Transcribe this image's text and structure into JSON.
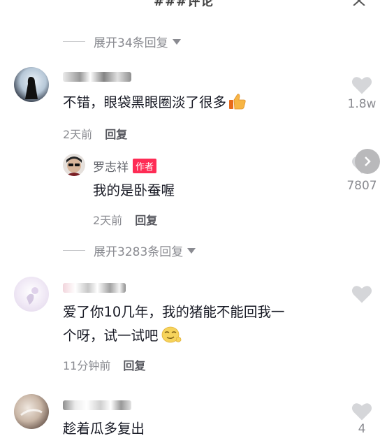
{
  "header": {
    "title": "###评论"
  },
  "thread1": {
    "expand_label": "展开34条回复"
  },
  "comment1": {
    "text": "不错，眼袋黑眼圈淡了很多",
    "time": "2天前",
    "reply_label": "回复",
    "likes": "1.8w"
  },
  "reply1": {
    "username": "罗志祥",
    "badge": "作者",
    "text": "我的是卧蚕喔",
    "time": "2天前",
    "reply_label": "回复",
    "likes": "7807"
  },
  "thread2": {
    "expand_label": "展开3283条回复"
  },
  "comment2": {
    "text_line1": "爱了你10几年，我的猪能不能回我一",
    "text_line2": "个呀，试一试吧",
    "time": "11分钟前",
    "reply_label": "回复"
  },
  "comment3": {
    "text": "趁着瓜多复出",
    "likes": "4"
  },
  "colors": {
    "accent": "#fe2c55",
    "muted": "#8a8b91",
    "heart": "#d5d6d9"
  },
  "icons": [
    "close-icon",
    "chevron-down-icon",
    "heart-icon",
    "thumbs-up-emoji",
    "smirk-emoji",
    "chevron-right-icon"
  ]
}
